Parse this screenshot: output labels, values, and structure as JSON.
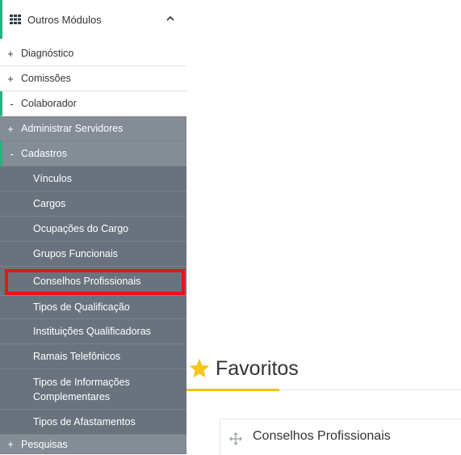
{
  "sidebar": {
    "header": {
      "label": "Outros Módulos",
      "icon": "grid-icon",
      "chevron": "chevron-up-icon"
    },
    "items": [
      {
        "sign": "+",
        "label": "Diagnóstico"
      },
      {
        "sign": "+",
        "label": "Comissões"
      },
      {
        "sign": "-",
        "label": "Colaborador"
      },
      {
        "sign": "+",
        "label": "Administrar Servidores"
      },
      {
        "sign": "-",
        "label": "Cadastros"
      }
    ],
    "subitems": [
      "Vínculos",
      "Cargos",
      "Ocupações do Cargo",
      "Grupos Funcionais",
      "Conselhos Profissionais",
      "Tipos de Qualificação",
      "Instituições Qualificadoras",
      "Ramais Telefônicos",
      "Tipos de Informações\nComplementares",
      "Tipos de Afastamentos"
    ],
    "footer_item": {
      "sign": "+",
      "label": "Pesquisas"
    }
  },
  "favorites": {
    "title": "Favoritos",
    "icon": "star-icon",
    "items": [
      {
        "icon": "move-icon",
        "label": "Conselhos Profissionais"
      }
    ]
  },
  "colors": {
    "accent_green": "#2bb07f",
    "sidebar_mid": "#848c96",
    "sidebar_dark": "#6a737d",
    "highlight_red": "#ee1111",
    "star_yellow": "#f5c518"
  }
}
